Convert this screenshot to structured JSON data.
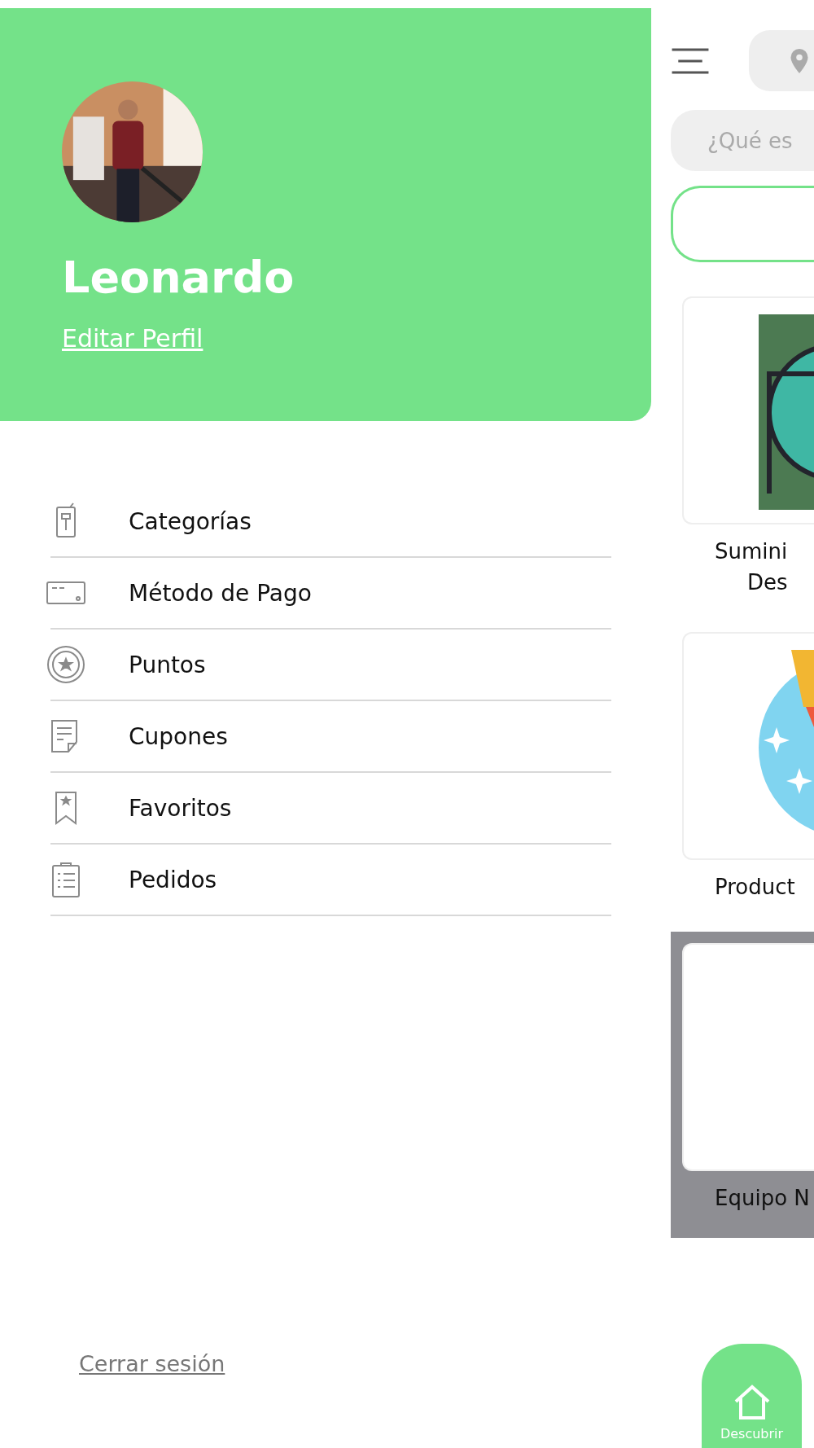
{
  "profile": {
    "name": "Leonardo",
    "edit_link": "Editar Perfil"
  },
  "menu": [
    {
      "label": "Categorías"
    },
    {
      "label": "Método de Pago"
    },
    {
      "label": "Puntos"
    },
    {
      "label": "Cupones"
    },
    {
      "label": "Favoritos"
    },
    {
      "label": "Pedidos"
    }
  ],
  "logout": "Cerrar sesión",
  "background_screen": {
    "search": {
      "placeholder": "¿Qué es"
    },
    "cards": [
      {
        "label_lines": [
          "Sumini",
          "Des"
        ],
        "highlighted": false
      },
      {
        "label_lines": [
          "Product"
        ],
        "highlighted": false
      },
      {
        "label_lines": [
          "Equipo N"
        ],
        "highlighted": true
      }
    ],
    "nav": [
      {
        "label": "Descubrir",
        "selected": true
      }
    ]
  }
}
